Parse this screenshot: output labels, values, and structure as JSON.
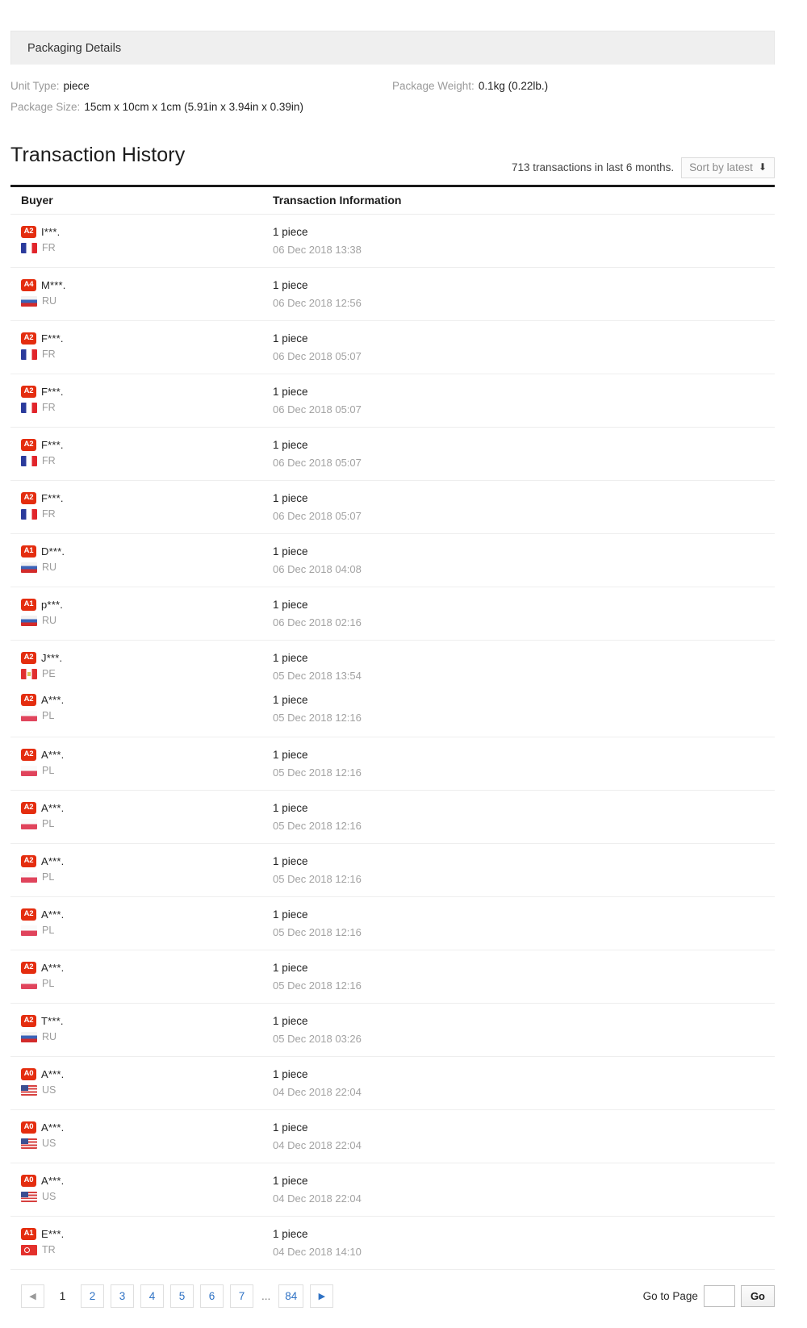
{
  "packaging": {
    "header_title": "Packaging Details",
    "unit_type_label": "Unit Type:",
    "unit_type_value": "piece",
    "package_weight_label": "Package Weight:",
    "package_weight_value": "0.1kg (0.22lb.)",
    "package_size_label": "Package Size:",
    "package_size_value": "15cm x 10cm x 1cm (5.91in x 3.94in x 0.39in)"
  },
  "transaction_history": {
    "title": "Transaction History",
    "count_text": "713 transactions in last 6 months.",
    "sort_label": "Sort by latest",
    "sort_arrow": "⬇",
    "columns": {
      "buyer": "Buyer",
      "info": "Transaction Information"
    },
    "rows": [
      {
        "badge": "A2",
        "name": "I***.",
        "country": "FR",
        "flag": "flag-fr",
        "qty": "1 piece",
        "date": "06 Dec 2018 13:38"
      },
      {
        "badge": "A4",
        "name": "M***.",
        "country": "RU",
        "flag": "flag-ru",
        "qty": "1 piece",
        "date": "06 Dec 2018 12:56"
      },
      {
        "badge": "A2",
        "name": "F***.",
        "country": "FR",
        "flag": "flag-fr",
        "qty": "1 piece",
        "date": "06 Dec 2018 05:07"
      },
      {
        "badge": "A2",
        "name": "F***.",
        "country": "FR",
        "flag": "flag-fr",
        "qty": "1 piece",
        "date": "06 Dec 2018 05:07"
      },
      {
        "badge": "A2",
        "name": "F***.",
        "country": "FR",
        "flag": "flag-fr",
        "qty": "1 piece",
        "date": "06 Dec 2018 05:07"
      },
      {
        "badge": "A2",
        "name": "F***.",
        "country": "FR",
        "flag": "flag-fr",
        "qty": "1 piece",
        "date": "06 Dec 2018 05:07"
      },
      {
        "badge": "A1",
        "name": "D***.",
        "country": "RU",
        "flag": "flag-ru",
        "qty": "1 piece",
        "date": "06 Dec 2018 04:08"
      },
      {
        "badge": "A1",
        "name": "p***.",
        "country": "RU",
        "flag": "flag-ru",
        "qty": "1 piece",
        "date": "06 Dec 2018 02:16"
      },
      {
        "badge": "A2",
        "name": "J***.",
        "country": "PE",
        "flag": "flag-pe",
        "qty": "1 piece",
        "date": "05 Dec 2018 13:54",
        "no_border": true
      },
      {
        "badge": "A2",
        "name": "A***.",
        "country": "PL",
        "flag": "flag-pl",
        "qty": "1 piece",
        "date": "05 Dec 2018 12:16",
        "tight": true
      },
      {
        "badge": "A2",
        "name": "A***.",
        "country": "PL",
        "flag": "flag-pl",
        "qty": "1 piece",
        "date": "05 Dec 2018 12:16"
      },
      {
        "badge": "A2",
        "name": "A***.",
        "country": "PL",
        "flag": "flag-pl",
        "qty": "1 piece",
        "date": "05 Dec 2018 12:16"
      },
      {
        "badge": "A2",
        "name": "A***.",
        "country": "PL",
        "flag": "flag-pl",
        "qty": "1 piece",
        "date": "05 Dec 2018 12:16"
      },
      {
        "badge": "A2",
        "name": "A***.",
        "country": "PL",
        "flag": "flag-pl",
        "qty": "1 piece",
        "date": "05 Dec 2018 12:16"
      },
      {
        "badge": "A2",
        "name": "A***.",
        "country": "PL",
        "flag": "flag-pl",
        "qty": "1 piece",
        "date": "05 Dec 2018 12:16"
      },
      {
        "badge": "A2",
        "name": "T***.",
        "country": "RU",
        "flag": "flag-ru",
        "qty": "1 piece",
        "date": "05 Dec 2018 03:26"
      },
      {
        "badge": "A0",
        "name": "A***.",
        "country": "US",
        "flag": "flag-us",
        "qty": "1 piece",
        "date": "04 Dec 2018 22:04"
      },
      {
        "badge": "A0",
        "name": "A***.",
        "country": "US",
        "flag": "flag-us",
        "qty": "1 piece",
        "date": "04 Dec 2018 22:04"
      },
      {
        "badge": "A0",
        "name": "A***.",
        "country": "US",
        "flag": "flag-us",
        "qty": "1 piece",
        "date": "04 Dec 2018 22:04"
      },
      {
        "badge": "A1",
        "name": "E***.",
        "country": "TR",
        "flag": "flag-tr",
        "qty": "1 piece",
        "date": "04 Dec 2018 14:10"
      }
    ]
  },
  "pagination": {
    "prev_glyph": "◀",
    "next_glyph": "▶",
    "pages": [
      "1",
      "2",
      "3",
      "4",
      "5",
      "6",
      "7"
    ],
    "current_page": "1",
    "ellipsis": "...",
    "last_page": "84",
    "goto_label": "Go to Page",
    "goto_value": "",
    "goto_placeholder": "",
    "go_button": "Go"
  }
}
